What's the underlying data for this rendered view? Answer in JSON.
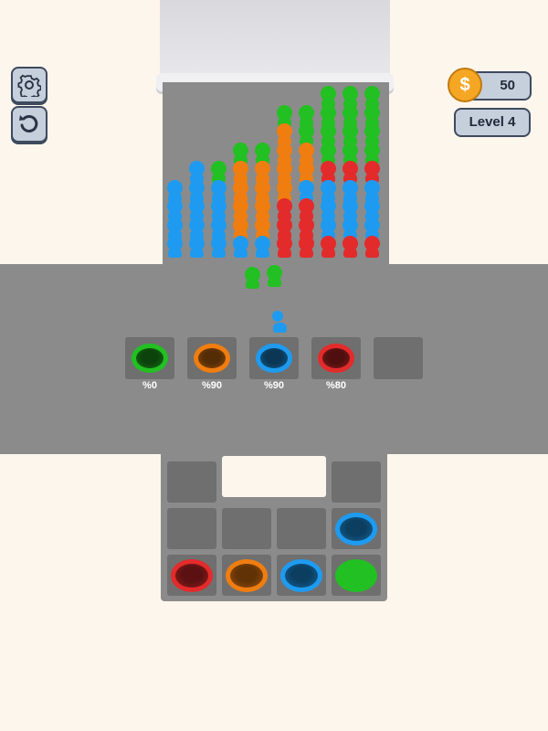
{
  "hud": {
    "coins": "50",
    "coin_symbol": "$",
    "level": "Level 4",
    "settings_icon": "gear-icon",
    "restart_icon": "restart-icon"
  },
  "colors": {
    "blue": "#1e9bf0",
    "orange": "#f07d10",
    "green": "#22c022",
    "red": "#e32b2b"
  },
  "crowd_columns": [
    {
      "stack": [
        "blue",
        "blue",
        "blue",
        "blue"
      ]
    },
    {
      "stack": [
        "blue",
        "blue",
        "blue",
        "blue",
        "blue"
      ]
    },
    {
      "stack": [
        "blue",
        "blue",
        "blue",
        "blue",
        "green"
      ]
    },
    {
      "stack": [
        "blue",
        "orange",
        "orange",
        "orange",
        "orange",
        "green"
      ]
    },
    {
      "stack": [
        "blue",
        "orange",
        "orange",
        "orange",
        "orange",
        "green"
      ]
    },
    {
      "stack": [
        "red",
        "red",
        "red",
        "orange",
        "orange",
        "orange",
        "orange",
        "green"
      ]
    },
    {
      "stack": [
        "red",
        "red",
        "red",
        "blue",
        "orange",
        "orange",
        "green",
        "green"
      ]
    },
    {
      "stack": [
        "red",
        "blue",
        "blue",
        "blue",
        "red",
        "green",
        "green",
        "green",
        "green"
      ]
    },
    {
      "stack": [
        "red",
        "blue",
        "blue",
        "blue",
        "red",
        "green",
        "green",
        "green",
        "green"
      ]
    },
    {
      "stack": [
        "red",
        "blue",
        "blue",
        "blue",
        "red",
        "green",
        "green",
        "green",
        "green"
      ]
    }
  ],
  "active_holes": [
    {
      "color": "green",
      "percent": "%0"
    },
    {
      "color": "orange",
      "percent": "%90"
    },
    {
      "color": "blue",
      "percent": "%90"
    },
    {
      "color": "red",
      "percent": "%80"
    },
    {
      "color": "",
      "percent": ""
    }
  ],
  "storage_grid": [
    [
      "",
      "",
      "",
      ""
    ],
    [
      "",
      "",
      "",
      "blue"
    ],
    [
      "red",
      "orange",
      "blue",
      "green"
    ]
  ]
}
